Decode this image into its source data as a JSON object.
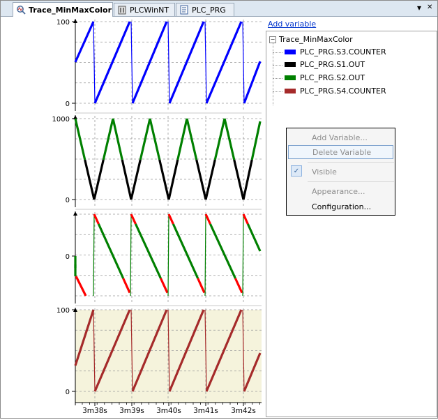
{
  "tabs": [
    {
      "label": "Trace_MinMaxColor",
      "icon": "trace-icon",
      "active": true
    },
    {
      "label": "PLCWinNT",
      "icon": "plc-device-icon",
      "active": false
    },
    {
      "label": "PLC_PRG",
      "icon": "program-document-icon",
      "active": false
    }
  ],
  "tab_controls": {
    "dropdown": "▾",
    "close": "✕"
  },
  "side_panel": {
    "add_variable_link": "Add variable",
    "tree_root": "Trace_MinMaxColor",
    "variables": [
      {
        "name": "PLC_PRG.S3.COUNTER",
        "color": "#0000ff"
      },
      {
        "name": "PLC_PRG.S1.OUT",
        "color": "#000000"
      },
      {
        "name": "PLC_PRG.S2.OUT",
        "color": "#008000"
      },
      {
        "name": "PLC_PRG.S4.COUNTER",
        "color": "#a52a2a"
      }
    ]
  },
  "context_menu": {
    "items": [
      {
        "label": "Add Variable...",
        "enabled": false
      },
      {
        "label": "Delete Variable",
        "enabled": false,
        "highlighted": true
      },
      {
        "label": "Visible",
        "enabled": false,
        "checked": true
      },
      {
        "label": "Appearance...",
        "enabled": false
      },
      {
        "label": "Configuration...",
        "enabled": true
      }
    ]
  },
  "chart_data": [
    {
      "type": "line",
      "series": [
        {
          "name": "PLC_PRG.S3.COUNTER",
          "color": "#0000ff",
          "waveform": "sawtooth",
          "min": 0,
          "max": 100
        }
      ],
      "y_ticks": [
        "100",
        "0"
      ],
      "ylim": [
        0,
        100
      ],
      "grid": true
    },
    {
      "type": "line",
      "series": [
        {
          "name": "PLC_PRG.S2.OUT",
          "color": "#008000",
          "waveform": "triangle",
          "min": 0,
          "max": 1000,
          "segment_above": 500
        },
        {
          "name": "PLC_PRG.S1.OUT",
          "color": "#000000",
          "waveform": "triangle",
          "min": 0,
          "max": 1000,
          "segment_below": 500
        }
      ],
      "y_ticks": [
        "1000",
        "0"
      ],
      "ylim": [
        0,
        1000
      ],
      "grid": true
    },
    {
      "type": "line",
      "series": [
        {
          "name": "PLC_PRG.S2.OUT",
          "color": "#008000",
          "min_max_color": "#ff0000",
          "waveform": "descending-sawtooth",
          "min": -1,
          "max": 1
        }
      ],
      "y_ticks": [
        "0"
      ],
      "ylim": [
        -1,
        1
      ],
      "grid": true
    },
    {
      "type": "line",
      "series": [
        {
          "name": "PLC_PRG.S4.COUNTER",
          "color": "#a52a2a",
          "waveform": "sawtooth",
          "min": 0,
          "max": 100
        }
      ],
      "y_ticks": [
        "100",
        "0"
      ],
      "ylim": [
        0,
        100
      ],
      "grid": true,
      "background": "#f5f3dc"
    }
  ],
  "x_axis": {
    "ticks": [
      "3m38s",
      "3m39s",
      "3m40s",
      "3m41s",
      "3m42s"
    ]
  }
}
